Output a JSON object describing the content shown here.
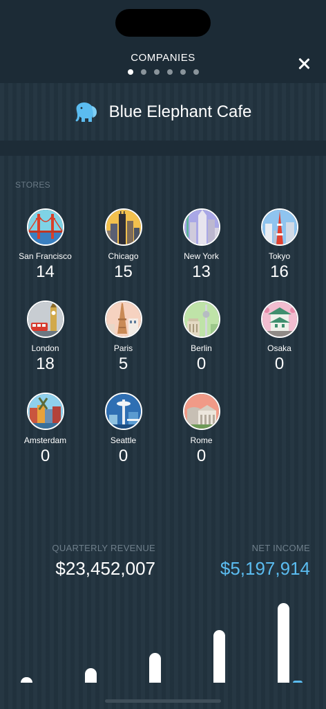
{
  "header": {
    "title": "COMPANIES",
    "page_count": 6,
    "active_page": 0,
    "close_icon": "close-icon"
  },
  "company": {
    "name": "Blue Elephant Cafe",
    "icon": "elephant-icon",
    "icon_color": "#5bbcf0"
  },
  "stores": {
    "label": "STORES",
    "cities": [
      {
        "name": "San Francisco",
        "count": "14",
        "icon": "golden-gate-icon",
        "bg": "#7fd3e6"
      },
      {
        "name": "Chicago",
        "count": "15",
        "icon": "chicago-skyline-icon",
        "bg": "#f2c04e"
      },
      {
        "name": "New York",
        "count": "13",
        "icon": "new-york-skyline-icon",
        "bg": "#a9a7e6"
      },
      {
        "name": "Tokyo",
        "count": "16",
        "icon": "tokyo-tower-icon",
        "bg": "#8fc4ef"
      },
      {
        "name": "London",
        "count": "18",
        "icon": "big-ben-icon",
        "bg": "#c8cdd2"
      },
      {
        "name": "Paris",
        "count": "5",
        "icon": "eiffel-tower-icon",
        "bg": "#f6d2c0"
      },
      {
        "name": "Berlin",
        "count": "0",
        "icon": "berlin-tv-tower-icon",
        "bg": "#bfe3a8"
      },
      {
        "name": "Osaka",
        "count": "0",
        "icon": "osaka-castle-icon",
        "bg": "#f2bdd0"
      },
      {
        "name": "Amsterdam",
        "count": "0",
        "icon": "amsterdam-houses-icon",
        "bg": "#8fd0ec"
      },
      {
        "name": "Seattle",
        "count": "0",
        "icon": "space-needle-icon",
        "bg": "#2f6fb3"
      },
      {
        "name": "Rome",
        "count": "0",
        "icon": "colosseum-icon",
        "bg": "#f19a87"
      }
    ]
  },
  "finance": {
    "revenue_label": "QUARTERLY REVENUE",
    "revenue_value": "$23,452,007",
    "net_label": "NET INCOME",
    "net_value": "$5,197,914",
    "accent": "#5bbcf0"
  }
}
